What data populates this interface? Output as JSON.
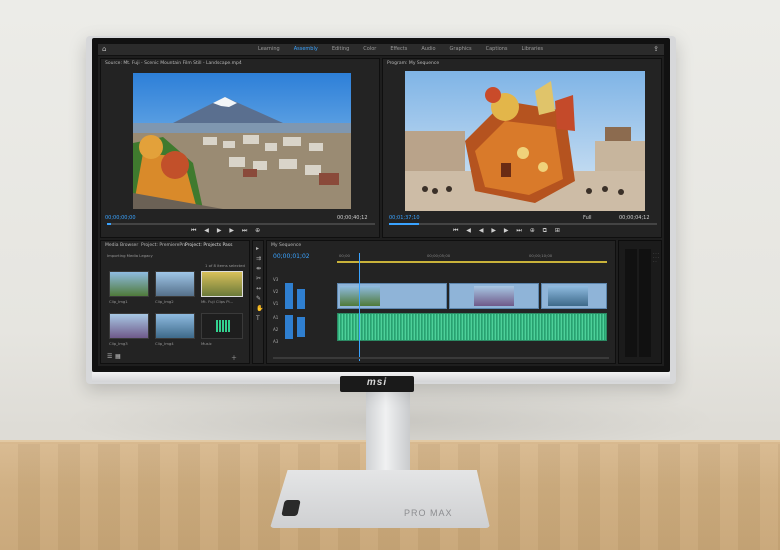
{
  "scene": {
    "monitor_brand": "msi",
    "base_label": "PRO MAX"
  },
  "app": {
    "workspace_tabs": [
      "Learning",
      "Assembly",
      "Editing",
      "Color",
      "Effects",
      "Audio",
      "Graphics",
      "Captions",
      "Libraries"
    ],
    "active_tab_index": 1
  },
  "source_monitor": {
    "title": "Source: Mt. Fuji - Scenic Mountain Film Still - Landscape.mp4",
    "timecode_in": "00;00;00;00",
    "timecode_dur": "00;00;40;12"
  },
  "program_monitor": {
    "title": "Program: My Sequence",
    "timecode_in": "00;01;37;10",
    "zoom": "Full",
    "timecode_dur": "00;00;04;12"
  },
  "project_panel": {
    "tabs": [
      "Media Browser",
      "Project: PremierePro",
      "Project: Projects Pass"
    ],
    "path": "Importing Media Legacy",
    "count": "1 of 8 items selected",
    "thumbs": [
      {
        "label": "Clip_Img1"
      },
      {
        "label": "Clip_Img2"
      },
      {
        "label": "Mt. Fuji Clips Pi..."
      },
      {
        "label": "Clip_Img3"
      },
      {
        "label": "Clip_Img4"
      },
      {
        "label": "Music"
      }
    ]
  },
  "timeline": {
    "title": "My Sequence",
    "timecode": "00;00;01;02",
    "ruler": [
      "00;00",
      "00;00;05;00",
      "00;00;10;00"
    ],
    "tracks": [
      "V3",
      "V2",
      "V1",
      "A1",
      "A2",
      "A3"
    ]
  },
  "colors": {
    "accent": "#3aa3ff",
    "video_clip": "#8fb4d8",
    "audio_clip": "#33b37f"
  }
}
